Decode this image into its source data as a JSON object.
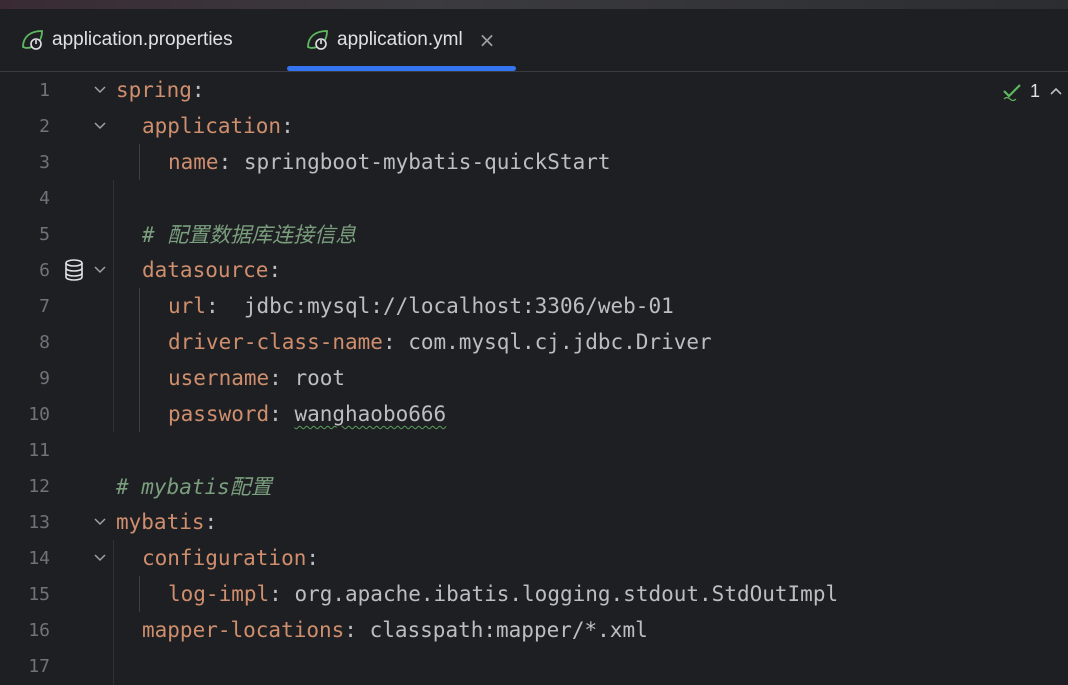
{
  "tabs": [
    {
      "label": "application.properties",
      "icon": "spring-leaf-icon",
      "active": false
    },
    {
      "label": "application.yml",
      "icon": "spring-leaf-icon",
      "active": true,
      "close": "×"
    }
  ],
  "inspection": {
    "count": "1",
    "icon": "check-icon"
  },
  "colors": {
    "background": "#1e1f22",
    "key": "#cf8e6d",
    "value": "#bcbec4",
    "comment": "#7a9e7e",
    "line_number": "#6f737a",
    "accent": "#3574f0"
  },
  "editor": {
    "lines": [
      {
        "num": "1",
        "key": "spring",
        "sep": ":",
        "value": "",
        "comment": ""
      },
      {
        "num": "2",
        "key": "application",
        "sep": ":",
        "value": "",
        "comment": ""
      },
      {
        "num": "3",
        "key": "name",
        "sep": ": ",
        "value": "springboot-mybatis-quickStart",
        "comment": ""
      },
      {
        "num": "4",
        "key": "",
        "sep": "",
        "value": "",
        "comment": ""
      },
      {
        "num": "5",
        "key": "",
        "sep": "",
        "value": "",
        "comment": "# 配置数据库连接信息"
      },
      {
        "num": "6",
        "key": "datasource",
        "sep": ":",
        "value": "",
        "comment": ""
      },
      {
        "num": "7",
        "key": "url",
        "sep": ":  ",
        "value": "jdbc:mysql://localhost:3306/web-01",
        "comment": ""
      },
      {
        "num": "8",
        "key": "driver-class-name",
        "sep": ": ",
        "value": "com.mysql.cj.jdbc.Driver",
        "comment": ""
      },
      {
        "num": "9",
        "key": "username",
        "sep": ": ",
        "value": "root",
        "comment": ""
      },
      {
        "num": "10",
        "key": "password",
        "sep": ": ",
        "value": "wanghaobo666",
        "comment": ""
      },
      {
        "num": "11",
        "key": "",
        "sep": "",
        "value": "",
        "comment": ""
      },
      {
        "num": "12",
        "key": "",
        "sep": "",
        "value": "",
        "comment": "# mybatis配置"
      },
      {
        "num": "13",
        "key": "mybatis",
        "sep": ":",
        "value": "",
        "comment": ""
      },
      {
        "num": "14",
        "key": "configuration",
        "sep": ":",
        "value": "",
        "comment": ""
      },
      {
        "num": "15",
        "key": "log-impl",
        "sep": ": ",
        "value": "org.apache.ibatis.logging.stdout.StdOutImpl",
        "comment": ""
      },
      {
        "num": "16",
        "key": "mapper-locations",
        "sep": ": ",
        "value": "classpath:mapper/*.xml",
        "comment": ""
      },
      {
        "num": "17",
        "key": "",
        "sep": "",
        "value": "",
        "comment": ""
      }
    ]
  }
}
